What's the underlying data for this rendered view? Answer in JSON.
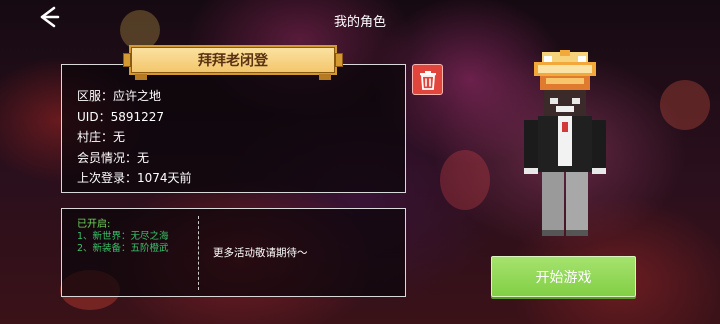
{
  "header": {
    "title": "我的角色",
    "back_icon": "chevron-left-icon"
  },
  "character": {
    "name": "拜拜老闭登",
    "info_lines": [
      "区服：应许之地",
      "UID：5891227",
      "村庄：无",
      "会员情况：无",
      "上次登录：1074天前"
    ]
  },
  "delete": {
    "icon": "trash-icon",
    "color": "#e2453c"
  },
  "news": {
    "heading": "已开启:",
    "items": [
      "1、新世界：无尽之海",
      "2、新装备：五阶橙武"
    ],
    "coming_soon": "更多活动敬请期待～"
  },
  "start_button": {
    "label": "开始游戏",
    "color": "#8fd653"
  },
  "colors": {
    "banner": "#f3c56a",
    "news_green": "#39c16a",
    "panel_border": "#d9d9d9"
  }
}
